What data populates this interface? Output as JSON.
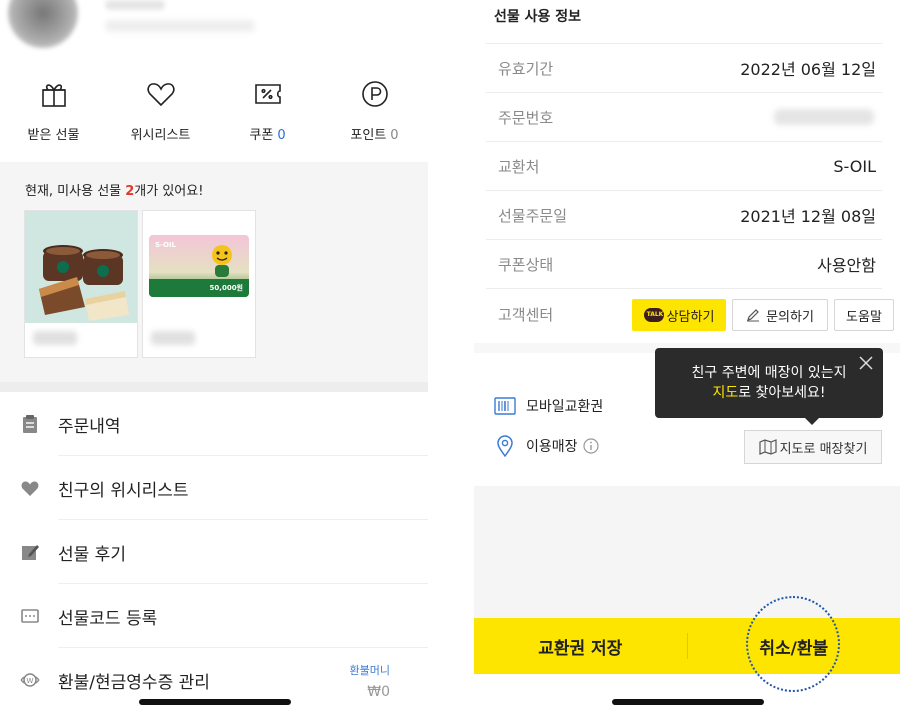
{
  "left": {
    "quick": [
      {
        "label": "받은 선물",
        "count": "",
        "icon": "gift-icon"
      },
      {
        "label": "위시리스트",
        "count": "",
        "icon": "heart-icon"
      },
      {
        "label": "쿠폰",
        "count": "0",
        "icon": "coupon-icon"
      },
      {
        "label": "포인트",
        "count": "0",
        "icon": "point-icon"
      }
    ],
    "gift_msg": {
      "prefix": "현재, 미사용 선물 ",
      "count": "2",
      "suffix": "개가 있어요!"
    },
    "soil_card": {
      "brand": "S-OIL",
      "amount": "50,000원"
    },
    "menu": [
      {
        "label": "주문내역",
        "icon": "clipboard-icon"
      },
      {
        "label": "친구의 위시리스트",
        "icon": "heart-filled-icon"
      },
      {
        "label": "선물 후기",
        "icon": "edit-icon"
      },
      {
        "label": "선물코드 등록",
        "icon": "code-icon"
      },
      {
        "label": "환불/현금영수증 관리",
        "icon": "refund-icon",
        "right_label": "환불머니",
        "right_value": "₩0"
      }
    ]
  },
  "right": {
    "section_title": "선물 사용 정보",
    "rows": [
      {
        "key": "유효기간",
        "value": "2022년 06월 12일"
      },
      {
        "key": "주문번호",
        "value": ""
      },
      {
        "key": "교환처",
        "value": "S-OIL"
      },
      {
        "key": "선물주문일",
        "value": "2021년 12월 08일"
      },
      {
        "key": "쿠폰상태",
        "value": "사용안함"
      },
      {
        "key": "고객센터",
        "value": ""
      }
    ],
    "cs_buttons": {
      "chat": "상담하기",
      "chat_badge": "TALK",
      "inquiry": "문의하기",
      "help": "도움말"
    },
    "mobile_voucher": "모바일교환권",
    "store_label": "이용매장",
    "map_button": "지도로 매장찾기",
    "tooltip": {
      "line1": "친구 주변에 매장이 있는지",
      "highlight": "지도",
      "line2_suffix": "로 찾아보세요!"
    },
    "bottom": {
      "save": "교환권 저장",
      "cancel": "취소/환불"
    }
  },
  "colors": {
    "kakao_yellow": "#fee500",
    "accent_blue": "#2a6fdb",
    "accent_red": "#e8352b",
    "tooltip_bg": "#2b2b2b"
  }
}
